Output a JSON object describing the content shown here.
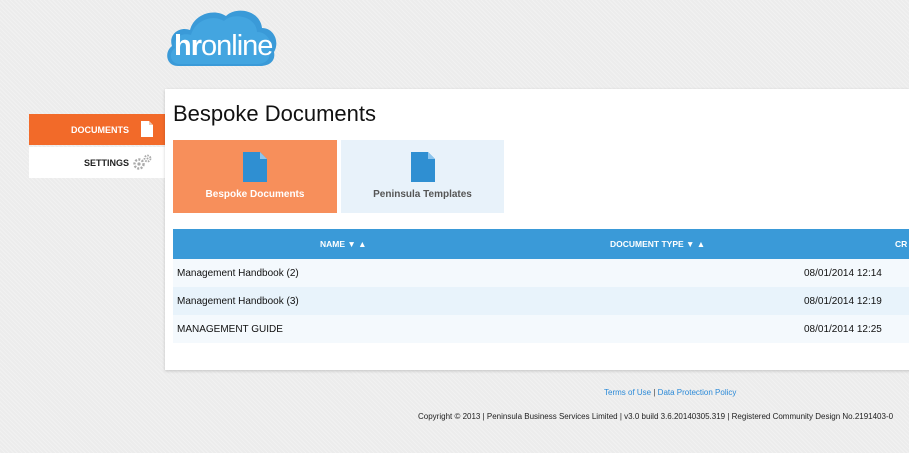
{
  "brand": {
    "logo_text_bold": "hr",
    "logo_text_light": "online",
    "cloud_color": "#3a9ad8"
  },
  "sidebar": {
    "items": [
      {
        "label": "DOCUMENTS",
        "icon": "document-icon",
        "active": true
      },
      {
        "label": "SETTINGS",
        "icon": "gear-icon",
        "active": false
      }
    ]
  },
  "main": {
    "title": "Bespoke Documents",
    "tiles": [
      {
        "label": "Bespoke Documents",
        "icon": "document-icon",
        "active": true
      },
      {
        "label": "Peninsula Templates",
        "icon": "document-icon",
        "active": false
      }
    ],
    "table": {
      "columns": [
        "NAME ▼ ▲",
        "DOCUMENT TYPE ▼ ▲",
        "CR"
      ],
      "rows": [
        {
          "name": "Management Handbook (2)",
          "date": "08/01/2014 12:14"
        },
        {
          "name": "Management Handbook (3)",
          "date": "08/01/2014 12:19"
        },
        {
          "name": "MANAGEMENT GUIDE",
          "date": "08/01/2014 12:25"
        }
      ]
    }
  },
  "footer": {
    "terms": "Terms of Use",
    "separator": "|",
    "privacy": "Data Protection Policy",
    "copyright": "Copyright © 2013 | Peninsula Business Services Limited | v3.0 build 3.6.20140305.319 | Registered Community Design No.2191403-0"
  },
  "colors": {
    "accent": "#f26a29",
    "tile_active": "#f78f5b",
    "header_blue": "#3a9ad8",
    "row_alt": "#e8f3fb",
    "row_base": "#f4f9fd"
  }
}
